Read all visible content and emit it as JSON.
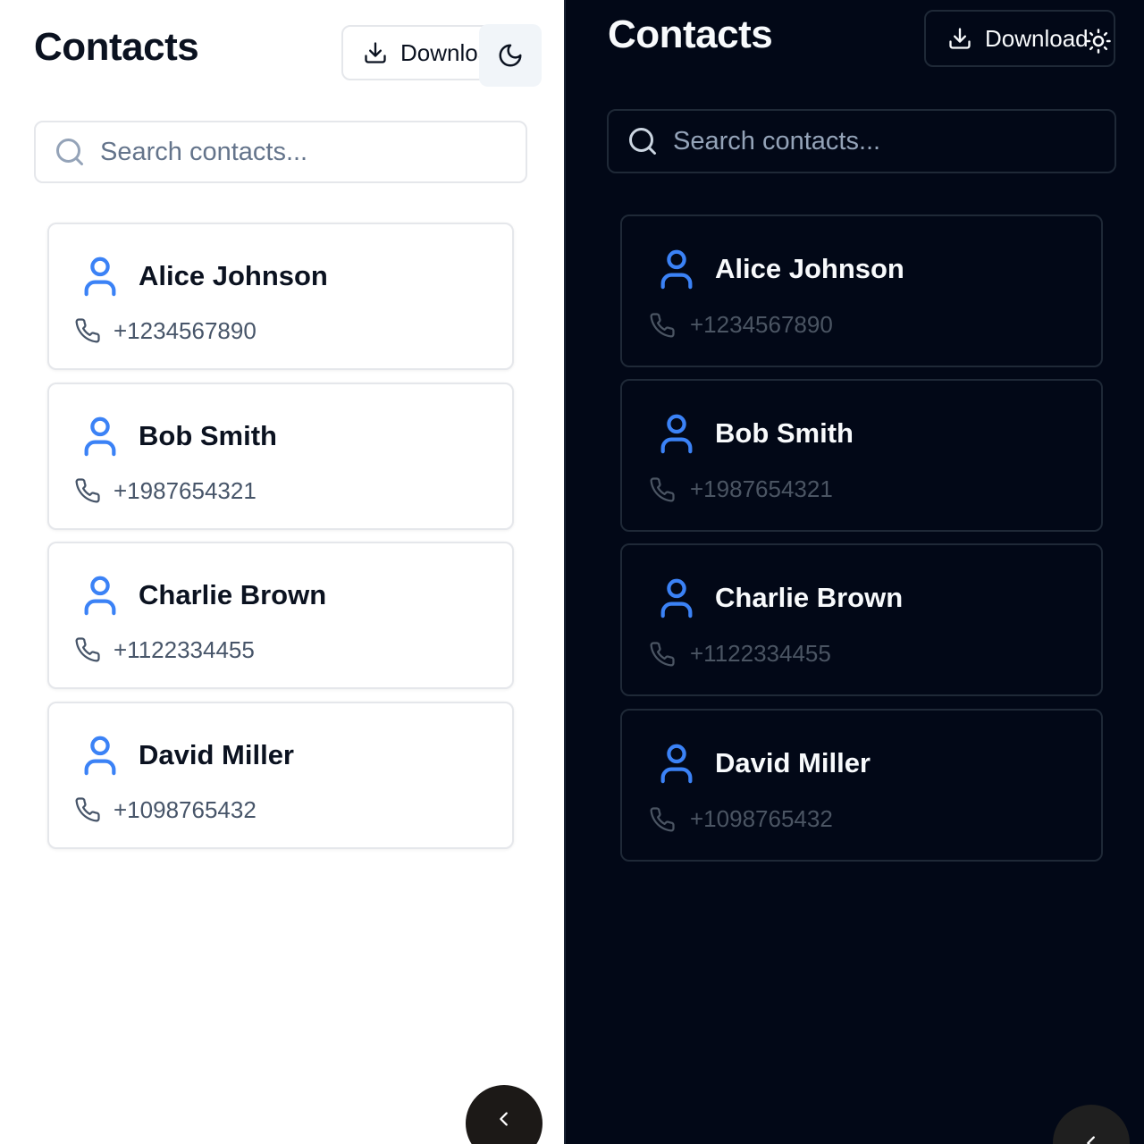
{
  "light": {
    "title": "Contacts",
    "download_label": "Download",
    "theme_toggle_icon": "moon-icon",
    "search": {
      "placeholder": "Search contacts..."
    },
    "contacts": [
      {
        "name": "Alice Johnson",
        "phone": "+1234567890"
      },
      {
        "name": "Bob Smith",
        "phone": "+1987654321"
      },
      {
        "name": "Charlie Brown",
        "phone": "+1122334455"
      },
      {
        "name": "David Miller",
        "phone": "+1098765432"
      }
    ],
    "fab_icon": "chevron-left-icon"
  },
  "dark": {
    "title": "Contacts",
    "download_label": "Download",
    "theme_toggle_icon": "sun-icon",
    "search": {
      "placeholder": "Search contacts..."
    },
    "contacts": [
      {
        "name": "Alice Johnson",
        "phone": "+1234567890"
      },
      {
        "name": "Bob Smith",
        "phone": "+1987654321"
      },
      {
        "name": "Charlie Brown",
        "phone": "+1122334455"
      },
      {
        "name": "David Miller",
        "phone": "+1098765432"
      }
    ],
    "fab_icon": "chevron-left-icon"
  },
  "colors": {
    "accent": "#3b82f6",
    "light_bg": "#ffffff",
    "dark_bg": "#020817",
    "light_text": "#0b1220",
    "dark_text": "#f8fafc"
  }
}
